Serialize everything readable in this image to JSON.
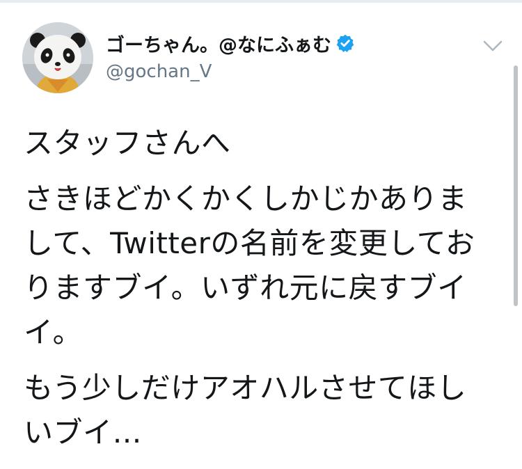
{
  "tweet": {
    "display_name": "ゴーちゃん。@なにふぁむ",
    "handle": "@gochan_V",
    "verified": true,
    "body_lines": [
      "スタッフさんへ",
      "",
      "さきほどかくかくしかじかありま",
      "して、Twitterの名前を変更してお",
      "りますブイ。いずれ元に戻すブイ",
      "イ。",
      "",
      "もう少しだけアオハルさせてほし",
      "いブイ…"
    ]
  },
  "icons": {
    "verified": "verified-badge-icon",
    "menu": "chevron-down-icon",
    "avatar": "panda-mascot-avatar"
  },
  "colors": {
    "text": "#14171a",
    "handle": "#657786",
    "verified": "#1da1f2",
    "chevron": "#aab8c2"
  }
}
